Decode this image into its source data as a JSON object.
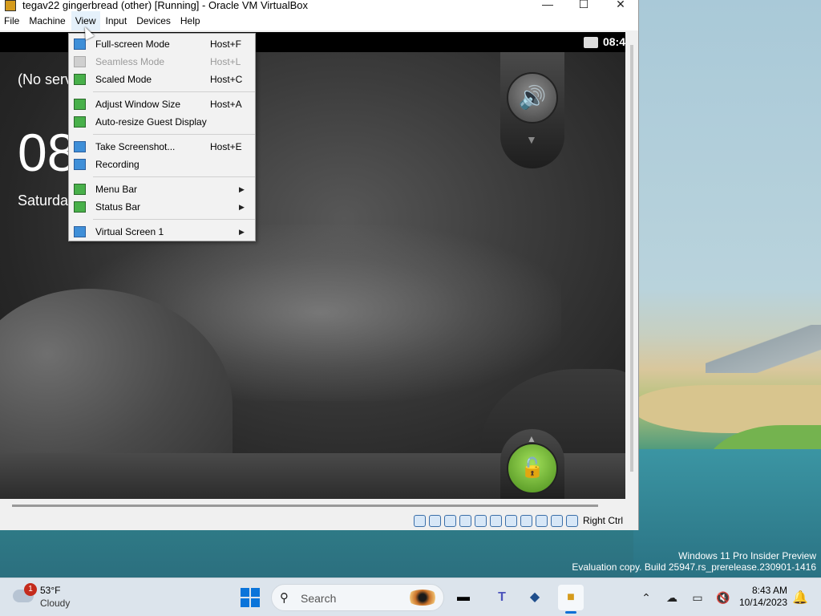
{
  "window": {
    "title": "tegav22 gingerbread (other) [Running] - Oracle VM VirtualBox",
    "minimize": "—",
    "maximize": "☐",
    "close": "✕"
  },
  "menubar": {
    "items": [
      "File",
      "Machine",
      "View",
      "Input",
      "Devices",
      "Help"
    ],
    "active": "View"
  },
  "view_menu": {
    "items": [
      {
        "label": "Full-screen Mode",
        "shortcut": "Host+F",
        "icon": "fullscreen-icon"
      },
      {
        "label": "Seamless Mode",
        "shortcut": "Host+L",
        "icon": "seamless-icon",
        "disabled": true
      },
      {
        "label": "Scaled Mode",
        "shortcut": "Host+C",
        "icon": "scaled-icon"
      },
      {
        "label": "Adjust Window Size",
        "shortcut": "Host+A",
        "icon": "adjust-window-icon"
      },
      {
        "label": "Auto-resize Guest Display",
        "shortcut": "",
        "icon": "auto-resize-icon"
      },
      {
        "label": "Take Screenshot...",
        "shortcut": "Host+E",
        "icon": "screenshot-icon"
      },
      {
        "label": "Recording",
        "shortcut": "",
        "icon": "recording-icon"
      },
      {
        "label": "Menu Bar",
        "shortcut": "",
        "icon": "menu-bar-icon",
        "submenu": true
      },
      {
        "label": "Status Bar",
        "shortcut": "",
        "icon": "status-bar-icon",
        "submenu": true
      },
      {
        "label": "Virtual Screen 1",
        "shortcut": "",
        "icon": "virtual-screen-icon",
        "submenu": true
      }
    ]
  },
  "guest": {
    "status_clock": "08:4",
    "no_service": "(No serv",
    "big_clock": "08",
    "date": "Saturda",
    "sound_glyph": "🔊",
    "lock_glyph": "🔓",
    "up_chevron": "▲",
    "down_chevron": "▼"
  },
  "vbox_statusbar": {
    "icons": [
      "hard-disk-icon",
      "optical-drive-icon",
      "audio-icon",
      "network-icon",
      "usb-icon",
      "shared-folders-icon",
      "display-icon",
      "recording-icon",
      "cpu-icon",
      "mouse-integration-icon",
      "keyboard-icon"
    ],
    "host_key": "Right Ctrl"
  },
  "watermark": {
    "line1": "Windows 11 Pro Insider Preview",
    "line2": "Evaluation copy. Build 25947.rs_prerelease.230901-1416"
  },
  "taskbar": {
    "weather": {
      "badge": "1",
      "temp": "53°F",
      "condition": "Cloudy"
    },
    "search_placeholder": "Search",
    "apps": [
      "task-view-icon",
      "teams-icon",
      "virtualbox-icon",
      "virtualbox-vm-icon"
    ],
    "tray_icons": [
      "chevron-up-icon",
      "onedrive-offline-icon",
      "network-icon",
      "volume-muted-icon"
    ],
    "time": "8:43 AM",
    "date": "10/14/2023"
  },
  "colors": {
    "accent": "#0a74da",
    "vm_status_green": "#48b04a"
  }
}
